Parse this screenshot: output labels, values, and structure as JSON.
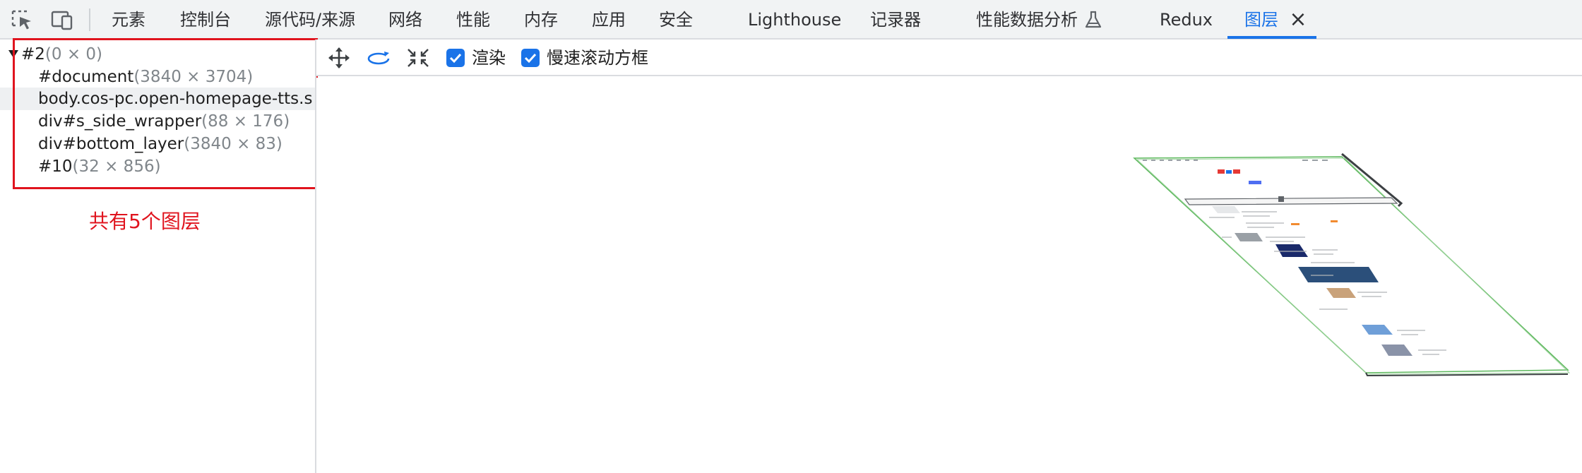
{
  "toolbar": {
    "inspect_icon": "element-picker-icon",
    "device_icon": "device-toggle-icon",
    "tabs": [
      {
        "label": "元素"
      },
      {
        "label": "控制台"
      },
      {
        "label": "源代码/来源"
      },
      {
        "label": "网络"
      },
      {
        "label": "性能"
      },
      {
        "label": "内存"
      },
      {
        "label": "应用"
      },
      {
        "label": "安全"
      },
      {
        "label": "Lighthouse"
      },
      {
        "label": "记录器"
      },
      {
        "label": "性能数据分析"
      },
      {
        "label": "Redux"
      },
      {
        "label": "图层"
      }
    ],
    "active_tab": "图层",
    "accent_color": "#1a73e8"
  },
  "layers_tree": {
    "rows": [
      {
        "name": "#2",
        "size": "(0 × 0)"
      },
      {
        "name": "#document",
        "size": "(3840 × 3704)"
      },
      {
        "name": "body.cos-pc.open-homepage-tts.s",
        "size": ""
      },
      {
        "name": "div#s_side_wrapper",
        "size": "(88 × 176)"
      },
      {
        "name": "div#bottom_layer",
        "size": "(3840 × 83)"
      },
      {
        "name": "#10",
        "size": "(32 × 856)"
      }
    ],
    "annotation": "共有5个图层",
    "annotation_color": "#e0141e"
  },
  "layers_toolbar": {
    "pan_icon": "pan-mode-icon",
    "rotate_icon": "rotate-mode-icon",
    "reset_icon": "reset-view-icon",
    "paints_label": "渲染",
    "paints_checked": true,
    "slow_scroll_label": "慢速滚动方框",
    "slow_scroll_checked": true
  }
}
